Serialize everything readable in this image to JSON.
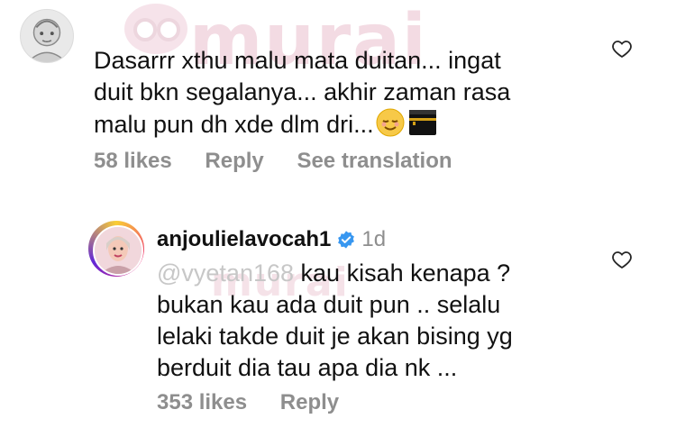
{
  "watermark": {
    "brand": "murai"
  },
  "comment": {
    "text": "Dasarrr xthu malu mata duitan... ingat\nduit bkn segalanya... akhir zaman rasa\nmalu pun dh xde dlm dri...",
    "emojis": [
      "relieved-face-emoji",
      "kaaba-emoji"
    ],
    "likes": "58 likes",
    "reply_label": "Reply",
    "translate_label": "See translation"
  },
  "reply": {
    "username": "anjoulielavocah1",
    "time": "1d",
    "mention": "@vyetan168",
    "text": "kau kisah kenapa ?\nbukan kau ada duit pun .. selalu\nlelaki takde duit je akan bising yg\nberduit dia tau apa dia nk ...",
    "likes": "353 likes",
    "reply_label": "Reply"
  },
  "icons": {
    "like": "heart-outline-icon",
    "verified": "verified-badge-icon"
  },
  "colors": {
    "text": "#111111",
    "meta": "#8e8e8e",
    "verified": "#3897f0",
    "mention": "#c7c7c7",
    "watermark": "#f3dbe3"
  }
}
